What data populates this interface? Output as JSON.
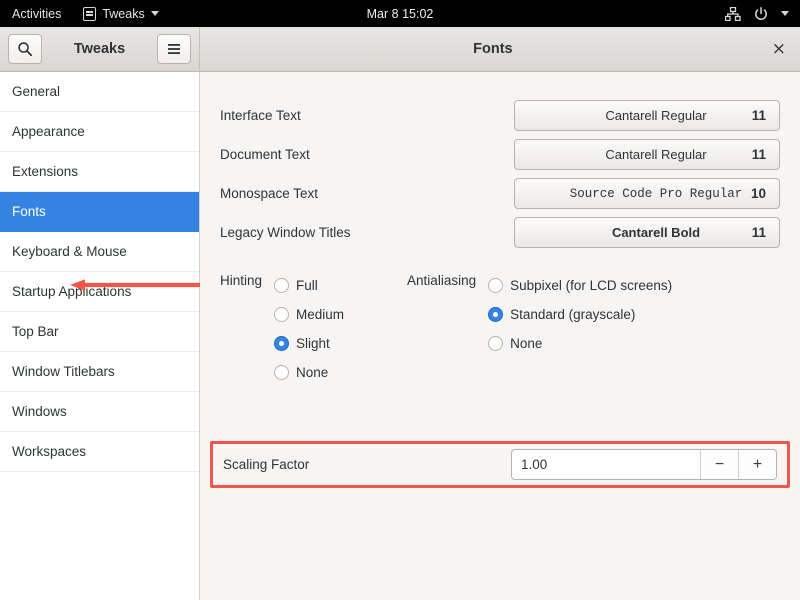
{
  "topbar": {
    "activities": "Activities",
    "app_name": "Tweaks",
    "app_icon": "tweaks-sliders-icon",
    "clock": "Mar 8  15:02",
    "network_icon": "network-wired-icon",
    "power_icon": "power-icon",
    "caret_icon": "chevron-down-icon"
  },
  "window": {
    "search_icon": "search-icon",
    "menu_icon": "hamburger-menu-icon",
    "sidebar_title": "Tweaks",
    "panel_title": "Fonts",
    "close_label": "×"
  },
  "sidebar": {
    "items": [
      {
        "label": "General",
        "selected": false
      },
      {
        "label": "Appearance",
        "selected": false
      },
      {
        "label": "Extensions",
        "selected": false
      },
      {
        "label": "Fonts",
        "selected": true
      },
      {
        "label": "Keyboard & Mouse",
        "selected": false
      },
      {
        "label": "Startup Applications",
        "selected": false
      },
      {
        "label": "Top Bar",
        "selected": false
      },
      {
        "label": "Window Titlebars",
        "selected": false
      },
      {
        "label": "Windows",
        "selected": false
      },
      {
        "label": "Workspaces",
        "selected": false
      }
    ],
    "selected_color": "#3584e4",
    "annotation_arrow_color": "#f4554a"
  },
  "fonts": {
    "rows": [
      {
        "label": "Interface Text",
        "font": "Cantarell Regular",
        "size": "11",
        "style": "regular"
      },
      {
        "label": "Document Text",
        "font": "Cantarell Regular",
        "size": "11",
        "style": "regular"
      },
      {
        "label": "Monospace Text",
        "font": "Source Code Pro Regular",
        "size": "10",
        "style": "mono"
      },
      {
        "label": "Legacy Window Titles",
        "font": "Cantarell Bold",
        "size": "11",
        "style": "bold"
      }
    ]
  },
  "hinting": {
    "label": "Hinting",
    "options": [
      {
        "label": "Full",
        "selected": false
      },
      {
        "label": "Medium",
        "selected": false
      },
      {
        "label": "Slight",
        "selected": true
      },
      {
        "label": "None",
        "selected": false
      }
    ]
  },
  "antialiasing": {
    "label": "Antialiasing",
    "options": [
      {
        "label": "Subpixel (for LCD screens)",
        "selected": false
      },
      {
        "label": "Standard (grayscale)",
        "selected": true
      },
      {
        "label": "None",
        "selected": false
      }
    ]
  },
  "scaling": {
    "label": "Scaling Factor",
    "value": "1.00",
    "minus_label": "−",
    "plus_label": "+",
    "highlight_color": "#f4554a"
  }
}
